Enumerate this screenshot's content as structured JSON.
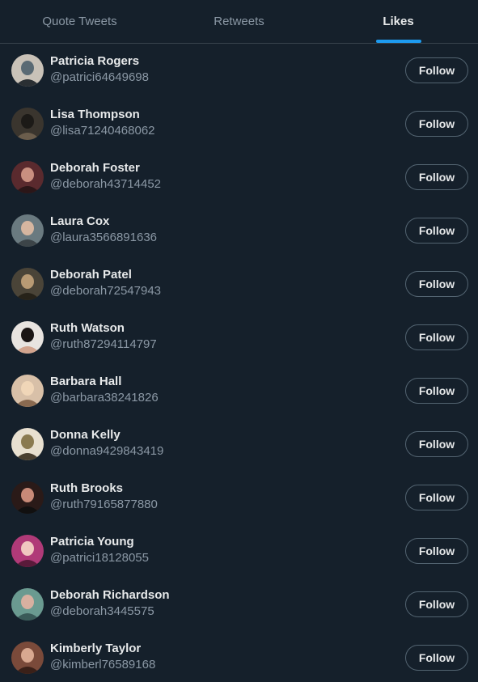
{
  "tabs": [
    {
      "label": "Quote Tweets",
      "active": false
    },
    {
      "label": "Retweets",
      "active": false
    },
    {
      "label": "Likes",
      "active": true
    }
  ],
  "colors": {
    "background": "#15202b",
    "accent": "#1d9bf0",
    "muted_text": "#8b98a5",
    "border": "#38444d"
  },
  "users": [
    {
      "name": "Patricia Rogers",
      "handle": "@patrici64649698",
      "follow_label": "Follow",
      "avatar": "avatar-photo",
      "avatar_colors": [
        "#c9c2b8",
        "#5a6a74",
        "#2a2f33"
      ]
    },
    {
      "name": "Lisa Thompson",
      "handle": "@lisa71240468062",
      "follow_label": "Follow",
      "avatar": "avatar-photo",
      "avatar_colors": [
        "#3a352e",
        "#1c1a17",
        "#6b5d4c"
      ]
    },
    {
      "name": "Deborah Foster",
      "handle": "@deborah43714452",
      "follow_label": "Follow",
      "avatar": "avatar-photo",
      "avatar_colors": [
        "#5a2a2e",
        "#c98f80",
        "#2b1618"
      ]
    },
    {
      "name": "Laura Cox",
      "handle": "@laura3566891636",
      "follow_label": "Follow",
      "avatar": "avatar-photo",
      "avatar_colors": [
        "#6a7a80",
        "#d6b6a0",
        "#3c4448"
      ]
    },
    {
      "name": "Deborah Patel",
      "handle": "@deborah72547943",
      "follow_label": "Follow",
      "avatar": "avatar-photo",
      "avatar_colors": [
        "#4a4438",
        "#b89a74",
        "#262219"
      ]
    },
    {
      "name": "Ruth Watson",
      "handle": "@ruth87294114797",
      "follow_label": "Follow",
      "avatar": "avatar-photo",
      "avatar_colors": [
        "#e8e4e0",
        "#1a1514",
        "#d2a48e"
      ]
    },
    {
      "name": "Barbara Hall",
      "handle": "@barbara38241826",
      "follow_label": "Follow",
      "avatar": "avatar-photo",
      "avatar_colors": [
        "#d8c0a8",
        "#f0d6b8",
        "#8a6a50"
      ]
    },
    {
      "name": "Donna Kelly",
      "handle": "@donna9429843419",
      "follow_label": "Follow",
      "avatar": "avatar-photo",
      "avatar_colors": [
        "#e8e0d0",
        "#8a7a50",
        "#4a4030"
      ]
    },
    {
      "name": "Ruth Brooks",
      "handle": "@ruth79165877880",
      "follow_label": "Follow",
      "avatar": "avatar-photo",
      "avatar_colors": [
        "#2a1a18",
        "#c88a78",
        "#111010"
      ]
    },
    {
      "name": "Patricia Young",
      "handle": "@patrici18128055",
      "follow_label": "Follow",
      "avatar": "avatar-photo",
      "avatar_colors": [
        "#b03a78",
        "#f0c8c0",
        "#5a1a3a"
      ]
    },
    {
      "name": "Deborah Richardson",
      "handle": "@deborah3445575",
      "follow_label": "Follow",
      "avatar": "avatar-photo",
      "avatar_colors": [
        "#6a9a90",
        "#d8b0a0",
        "#3a5a58"
      ]
    },
    {
      "name": "Kimberly Taylor",
      "handle": "@kimberl76589168",
      "follow_label": "Follow",
      "avatar": "avatar-photo",
      "avatar_colors": [
        "#7a4a3a",
        "#d8a890",
        "#3a2018"
      ]
    }
  ]
}
